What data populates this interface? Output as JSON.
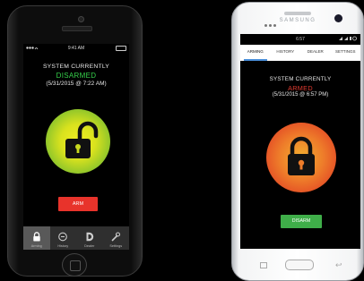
{
  "iphone": {
    "status_bar": {
      "carrier": "",
      "time": "9:41 AM"
    },
    "status_line1": "SYSTEM CURRENTLY",
    "status_line2": "DISARMED",
    "status_line3": "(5/31/2015 @ 7:22 AM)",
    "lock_state": "unlocked",
    "action_button": "ARM",
    "tabs": [
      {
        "label": "Arming",
        "icon": "lock-icon",
        "active": true
      },
      {
        "label": "History",
        "icon": "clock-icon",
        "active": false
      },
      {
        "label": "Dealer",
        "icon": "dealer-d-icon",
        "active": false
      },
      {
        "label": "Settings",
        "icon": "wrench-icon",
        "active": false
      }
    ]
  },
  "galaxy": {
    "brand": "SAMSUNG",
    "status_bar": {
      "time": "6:57"
    },
    "tabs": [
      {
        "label": "ARMING",
        "active": true
      },
      {
        "label": "HISTORY",
        "active": false
      },
      {
        "label": "DEALER",
        "active": false
      },
      {
        "label": "SETTINGS",
        "active": false
      }
    ],
    "status_line1": "SYSTEM CURRENTLY",
    "status_line2": "ARMED",
    "status_line3": "(5/31/2015 @ 6:57 PM)",
    "lock_state": "locked",
    "action_button": "DISARM"
  },
  "colors": {
    "disarmed_green": "#35d04a",
    "armed_red": "#e03a2f",
    "arm_button": "#e8332b",
    "disarm_button": "#3fae49",
    "active_tab_underline": "#4a8fd9"
  }
}
